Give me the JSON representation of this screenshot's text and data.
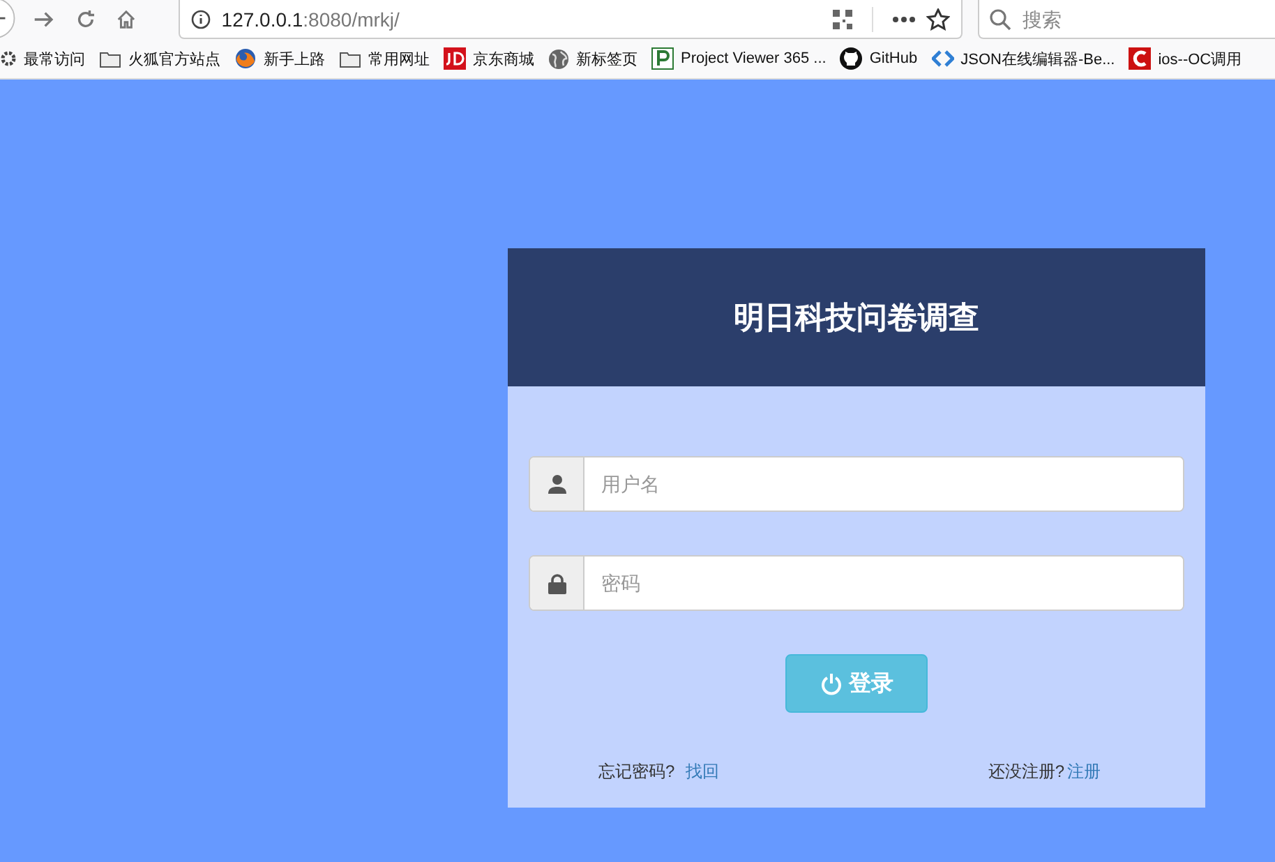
{
  "toolbar": {
    "url_host": "127.0.0.1",
    "url_path": ":8080/mrkj/",
    "search": {
      "placeholder": "搜索"
    }
  },
  "bookmarks": [
    {
      "kind": "gear",
      "label": "最常访问"
    },
    {
      "kind": "folder",
      "label": "火狐官方站点"
    },
    {
      "kind": "browser",
      "label": "新手上路"
    },
    {
      "kind": "folder",
      "label": "常用网址"
    },
    {
      "kind": "shop",
      "label": "京东商城"
    },
    {
      "kind": "globe",
      "label": "新标签页"
    },
    {
      "kind": "project",
      "label": "Project Viewer 365 ..."
    },
    {
      "kind": "github",
      "label": "GitHub"
    },
    {
      "kind": "code",
      "label": "JSON在线编辑器-Be..."
    },
    {
      "kind": "clogo",
      "label": "ios--OC调用"
    }
  ],
  "login": {
    "title": "明日科技问卷调查",
    "fields": [
      {
        "kind": "user",
        "placeholder": "用户名"
      },
      {
        "kind": "password",
        "placeholder": "密码"
      }
    ],
    "submit": "登录",
    "forgot": {
      "text": "忘记密码?",
      "link": "找回"
    },
    "register": {
      "text": "还没注册?",
      "link": "注册"
    }
  }
}
